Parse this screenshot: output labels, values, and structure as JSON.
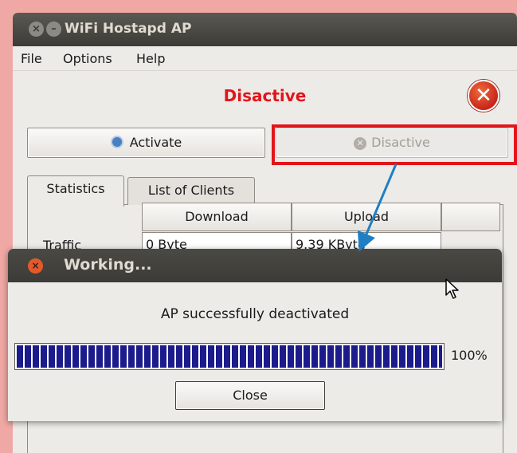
{
  "window": {
    "title": "WiFi Hostapd AP"
  },
  "menu": [
    "File",
    "Options",
    "Help"
  ],
  "status": {
    "text": "Disactive",
    "color": "#e0161b"
  },
  "buttons": {
    "activate": "Activate",
    "disactive": "Disactive"
  },
  "tabs": [
    "Statistics",
    "List of Clients"
  ],
  "stats": {
    "columns": [
      "Download",
      "Upload"
    ],
    "row_label": "Traffic",
    "download": "0 Byte",
    "upload": "9.39 KByte"
  },
  "dialog": {
    "title": "Working...",
    "message": "AP successfully deactivated",
    "progress_fraction": 1.0,
    "progress_text": "100%",
    "close_label": "Close"
  },
  "icons": {
    "status": "error-x-icon",
    "activate": "gear-icon",
    "disactive": "close-circle-icon",
    "cursor": "mouse-pointer-icon"
  },
  "colors": {
    "highlight_box": "#e0161b",
    "arrow": "#1f7fc4",
    "progress": "#1b1b8c"
  }
}
